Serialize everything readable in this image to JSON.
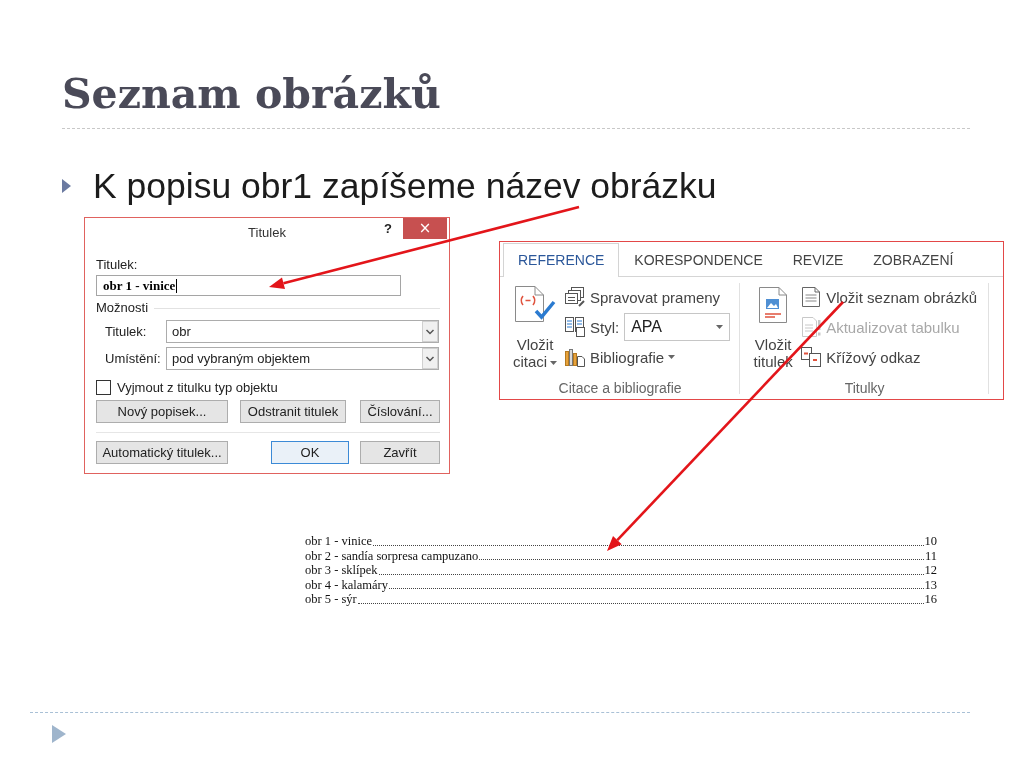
{
  "slide": {
    "title": "Seznam obrázků",
    "bullets": [
      {
        "text": "K popisu obr1 zapíšeme název obrázku"
      }
    ]
  },
  "caption_dialog": {
    "title": "Titulek",
    "help_button": "?",
    "close_button": "×",
    "caption_label": "Titulek:",
    "caption_value": "obr 1 - vinice",
    "options_heading": "Možnosti",
    "dropdowns": [
      {
        "label": "Titulek:",
        "value": "obr"
      },
      {
        "label": "Umístění:",
        "value": "pod vybraným objektem"
      }
    ],
    "exclude_option": {
      "label": "Vyjmout z titulku typ objektu",
      "checked": false
    },
    "button_rows": [
      {
        "buttons": [
          {
            "label": "Nový popisek...",
            "default": false
          },
          {
            "label": "Odstranit titulek",
            "default": false
          },
          {
            "label": "Číslování...",
            "default": false
          }
        ]
      },
      {
        "buttons": [
          {
            "label": "Automatický titulek...",
            "default": false
          },
          {
            "label": "OK",
            "default": true
          },
          {
            "label": "Zavřít",
            "default": false
          }
        ]
      }
    ]
  },
  "ribbon": {
    "tabs": [
      {
        "label": "REFERENCE",
        "selected": true
      },
      {
        "label": "KORESPONDENCE",
        "selected": false
      },
      {
        "label": "REVIZE",
        "selected": false
      },
      {
        "label": "ZOBRAZENÍ",
        "selected": false
      }
    ],
    "groups": [
      {
        "label": "Citace a bibliografie",
        "large_button": {
          "label": "Vložit citaci",
          "dropdown": true
        },
        "items": [
          {
            "kind": "button",
            "label": "Spravovat prameny",
            "dropdown": false,
            "disabled": false
          },
          {
            "kind": "select",
            "label": "Styl:",
            "value": "APA",
            "disabled": false
          },
          {
            "kind": "button",
            "label": "Bibliografie",
            "dropdown": true,
            "disabled": false
          }
        ]
      },
      {
        "label": "Titulky",
        "large_button": {
          "label": "Vložit titulek",
          "dropdown": false
        },
        "items": [
          {
            "kind": "button",
            "label": "Vložit seznam obrázků",
            "dropdown": false,
            "disabled": false
          },
          {
            "kind": "button",
            "label": "Aktualizovat tabulku",
            "dropdown": false,
            "disabled": true
          },
          {
            "kind": "button",
            "label": "Křížový odkaz",
            "dropdown": false,
            "disabled": false
          }
        ]
      }
    ]
  },
  "figures_list": [
    {
      "caption": "obr 1 - vinice",
      "page": "10"
    },
    {
      "caption": "obr 2 - sandía sorpresa campuzano",
      "page": "11"
    },
    {
      "caption": "obr 3 - sklípek",
      "page": "12"
    },
    {
      "caption": "obr 4 - kalamáry",
      "page": "13"
    },
    {
      "caption": "obr 5 - sýr",
      "page": "16"
    }
  ]
}
